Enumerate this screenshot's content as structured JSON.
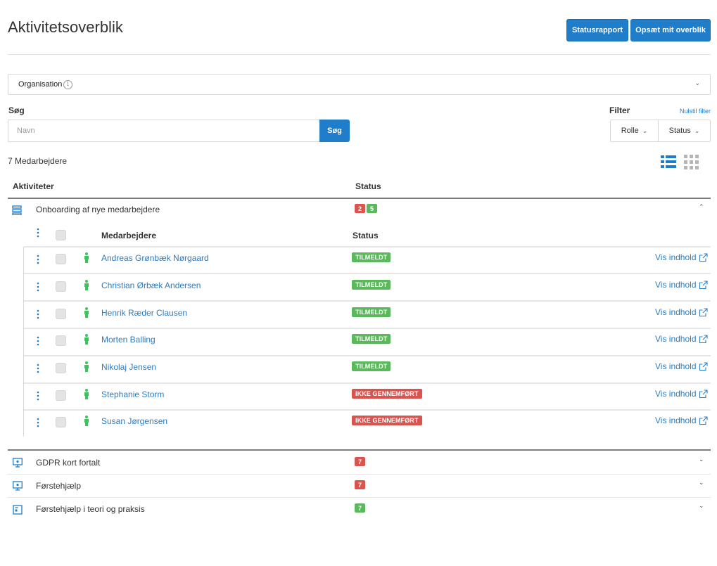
{
  "header": {
    "title": "Aktivitetsoverblik",
    "status_report_label": "Statusrapport",
    "setup_label": "Opsæt mit overblik"
  },
  "organisation": {
    "label": "Organisation",
    "info_glyph": "i"
  },
  "search": {
    "label": "Søg",
    "placeholder": "Navn",
    "button_label": "Søg"
  },
  "filter": {
    "label": "Filter",
    "reset_label": "Nulstil filter",
    "role_label": "Rolle",
    "status_label": "Status"
  },
  "employee_count": "7 Medarbejdere",
  "table": {
    "col_activities": "Aktiviteter",
    "col_status": "Status"
  },
  "activities": [
    {
      "title": "Onboarding af nye medarbejdere",
      "icon": "course-stack-icon",
      "badges": [
        {
          "value": "2",
          "color": "#d9534f"
        },
        {
          "value": "5",
          "color": "#5cb85c"
        }
      ],
      "expanded": true
    },
    {
      "title": "GDPR kort fortalt",
      "icon": "monitor-icon",
      "badges": [
        {
          "value": "7",
          "color": "#d9534f"
        }
      ],
      "expanded": false
    },
    {
      "title": "Førstehjælp",
      "icon": "monitor-icon",
      "badges": [
        {
          "value": "7",
          "color": "#d9534f"
        }
      ],
      "expanded": false
    },
    {
      "title": "Førstehjælp i teori og praksis",
      "icon": "document-icon",
      "badges": [
        {
          "value": "7",
          "color": "#5cb85c"
        }
      ],
      "expanded": false
    }
  ],
  "sub_table": {
    "col_employees": "Medarbejdere",
    "col_status": "Status",
    "view_label": "Vis indhold",
    "rows": [
      {
        "name": "Andreas Grønbæk Nørgaard",
        "status": "TILMELDT",
        "status_color": "#5cb85c"
      },
      {
        "name": "Christian Ørbæk Andersen",
        "status": "TILMELDT",
        "status_color": "#5cb85c"
      },
      {
        "name": "Henrik Ræder Clausen",
        "status": "TILMELDT",
        "status_color": "#5cb85c"
      },
      {
        "name": "Morten Balling",
        "status": "TILMELDT",
        "status_color": "#5cb85c"
      },
      {
        "name": "Nikolaj Jensen",
        "status": "TILMELDT",
        "status_color": "#5cb85c"
      },
      {
        "name": "Stephanie Storm",
        "status": "IKKE GENNEMFØRT",
        "status_color": "#d9534f"
      },
      {
        "name": "Susan Jørgensen",
        "status": "IKKE GENNEMFØRT",
        "status_color": "#d9534f"
      }
    ]
  },
  "colors": {
    "primary": "#1f7dc9",
    "link": "#2d7cc0",
    "success": "#5cb85c",
    "danger": "#d9534f",
    "person_icon": "#3cc35b"
  }
}
